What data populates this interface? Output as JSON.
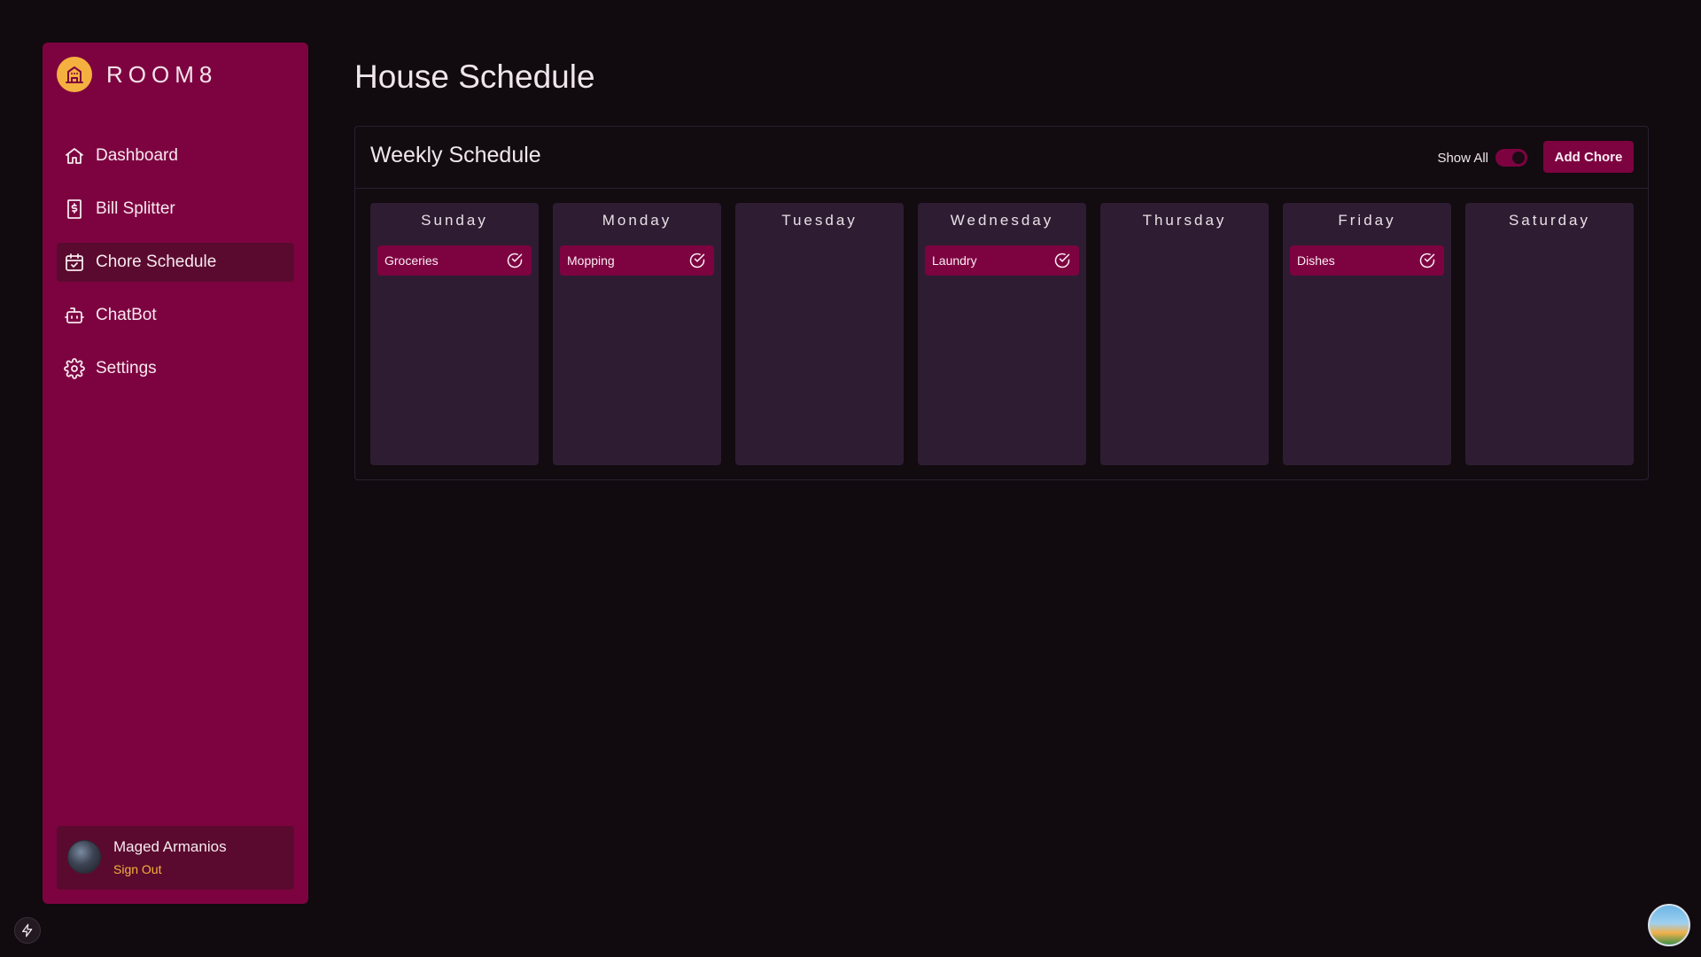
{
  "brand": {
    "name": "ROOM8",
    "logo_icon": "building-icon",
    "accent": "#f5b13f"
  },
  "sidebar": {
    "items": [
      {
        "label": "Dashboard",
        "icon": "home-icon",
        "active": false
      },
      {
        "label": "Bill Splitter",
        "icon": "receipt-icon",
        "active": false
      },
      {
        "label": "Chore Schedule",
        "icon": "calendar-icon",
        "active": true
      },
      {
        "label": "ChatBot",
        "icon": "bot-icon",
        "active": false
      },
      {
        "label": "Settings",
        "icon": "gear-icon",
        "active": false
      }
    ]
  },
  "user": {
    "name": "Maged Armanios",
    "sign_out_label": "Sign Out"
  },
  "page": {
    "title": "House Schedule"
  },
  "schedule": {
    "title": "Weekly Schedule",
    "show_all_label": "Show All",
    "show_all_on": true,
    "add_chore_label": "Add Chore",
    "days": [
      {
        "name": "Sunday",
        "chores": [
          "Groceries"
        ]
      },
      {
        "name": "Monday",
        "chores": [
          "Mopping"
        ]
      },
      {
        "name": "Tuesday",
        "chores": []
      },
      {
        "name": "Wednesday",
        "chores": [
          "Laundry"
        ]
      },
      {
        "name": "Thursday",
        "chores": []
      },
      {
        "name": "Friday",
        "chores": [
          "Dishes"
        ]
      },
      {
        "name": "Saturday",
        "chores": []
      }
    ]
  },
  "colors": {
    "sidebar_bg": "#7d0340",
    "active_item_bg": "#5a0a2e",
    "day_card_bg": "#2e1d32",
    "page_bg": "#110a0f"
  }
}
